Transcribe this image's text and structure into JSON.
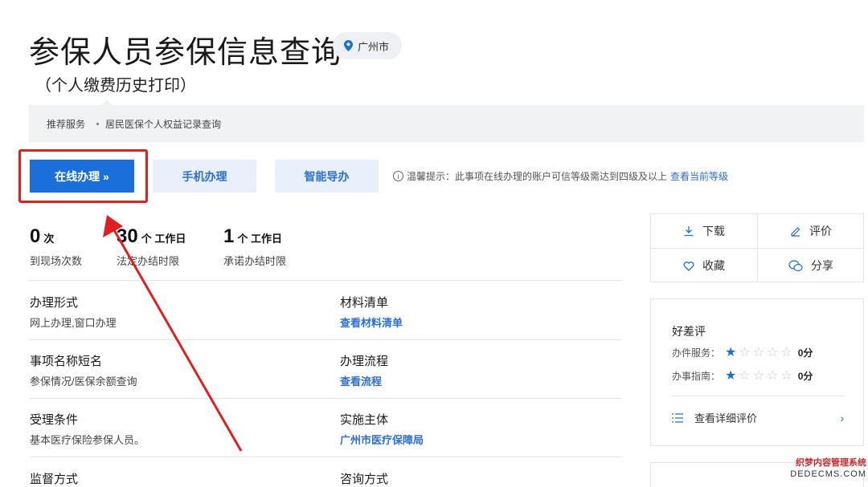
{
  "header": {
    "title": "参保人员参保信息查询",
    "subtitle": "（个人缴费历史打印）",
    "location": "广州市"
  },
  "recommend": {
    "label": "推荐服务",
    "item": "居民医保个人权益记录查询"
  },
  "actions": {
    "online": "在线办理 »",
    "mobile": "手机办理",
    "guide": "智能导办"
  },
  "tip": {
    "text": "温馨提示：此事项在线办理的账户可信等级需达到四级及以上",
    "link": "查看当前等级"
  },
  "stats": [
    {
      "num": "0",
      "unit": "次",
      "desc": "到现场次数"
    },
    {
      "num": "30",
      "unit": "个 工作日",
      "desc": "法定办结时限"
    },
    {
      "num": "1",
      "unit": "个 工作日",
      "desc": "承诺办结时限"
    }
  ],
  "fields": {
    "form": {
      "title": "办理形式",
      "value": "网上办理,窗口办理"
    },
    "materials": {
      "title": "材料清单",
      "link": "查看材料清单"
    },
    "short_name": {
      "title": "事项名称短名",
      "value": "参保情况/医保余额查询"
    },
    "process": {
      "title": "办理流程",
      "link": "查看流程"
    },
    "conditions": {
      "title": "受理条件",
      "value": "基本医疗保险参保人员。"
    },
    "subject": {
      "title": "实施主体",
      "link": "广州市医疗保障局"
    },
    "supervision": {
      "title": "监督方式"
    },
    "consult": {
      "title": "咨询方式"
    }
  },
  "side": {
    "download": "下载",
    "review": "评价",
    "favorite": "收藏",
    "share": "分享"
  },
  "rating": {
    "title": "好差评",
    "service_label": "办件服务：",
    "service_score": "0分",
    "service_stars": 1,
    "guide_label": "办事指南：",
    "guide_score": "0分",
    "guide_stars": 1,
    "detail": "查看详细评价"
  },
  "watermark": {
    "cn": "织梦内容管理系统",
    "en": "DEDECMS.COM"
  },
  "colors": {
    "primary": "#1a6fd9",
    "link": "#2f6fd0",
    "highlight": "#e02020"
  }
}
